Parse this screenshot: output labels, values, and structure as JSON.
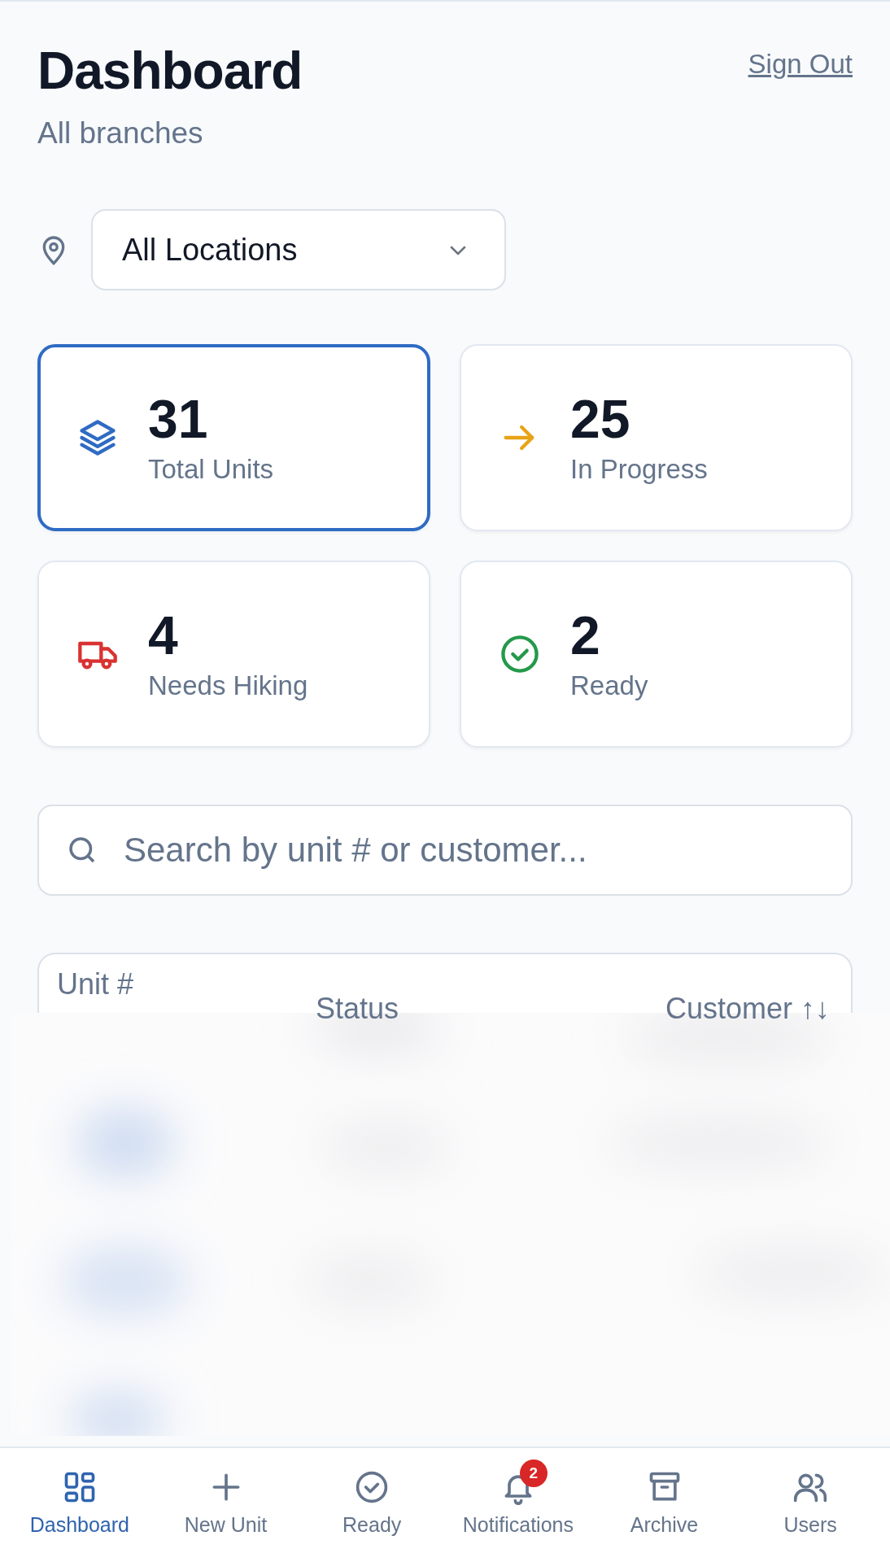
{
  "header": {
    "title": "Dashboard",
    "subtitle": "All branches",
    "sign_out": "Sign Out"
  },
  "location_filter": {
    "value": "All Locations"
  },
  "stats": [
    {
      "kind": "layers",
      "value": "31",
      "label": "Total Units",
      "color": "#2f6bc4",
      "selected": true
    },
    {
      "kind": "arrow",
      "value": "25",
      "label": "In Progress",
      "color": "#e8a317",
      "selected": false
    },
    {
      "kind": "truck",
      "value": "4",
      "label": "Needs Hiking",
      "color": "#d93232",
      "selected": false
    },
    {
      "kind": "check",
      "value": "2",
      "label": "Ready",
      "color": "#24994a",
      "selected": false
    }
  ],
  "search": {
    "placeholder": "Search by unit # or customer..."
  },
  "table": {
    "columns": [
      "Unit #",
      "Status",
      "Customer ↑↓"
    ]
  },
  "nav": [
    {
      "kind": "grid",
      "label": "Dashboard",
      "selected": true
    },
    {
      "kind": "plus",
      "label": "New Unit",
      "selected": false
    },
    {
      "kind": "check",
      "label": "Ready",
      "selected": false
    },
    {
      "kind": "bell",
      "label": "Notifications",
      "selected": false,
      "badge": "2"
    },
    {
      "kind": "archive",
      "label": "Archive",
      "selected": false
    },
    {
      "kind": "users",
      "label": "Users",
      "selected": false
    }
  ]
}
